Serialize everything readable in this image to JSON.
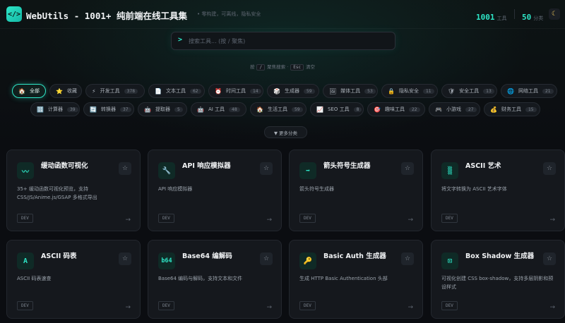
{
  "header": {
    "logo_glyph": "</>",
    "brand_en": "WebUtils - 1001+ ",
    "brand_cn": "纯前端在线工具集",
    "tagline": "• 零构建，可离线，隐私安全",
    "tools_count": "1001",
    "tools_label": "工具",
    "categories_count": "50",
    "categories_label": "分类",
    "theme_icon": "moon-icon"
  },
  "search": {
    "prompt": ">",
    "placeholder": "搜索工具... (按 / 聚焦)"
  },
  "hints": {
    "pre": "按",
    "key1": "/",
    "mid": "聚焦搜索 ·",
    "key2": "Esc",
    "post": "清空"
  },
  "categories": [
    {
      "icon": "🏠",
      "label": "全部",
      "count": "",
      "active": true
    },
    {
      "icon": "⭐",
      "label": "收藏",
      "count": ""
    },
    {
      "icon": "⚡",
      "label": "开发工具",
      "count": "378"
    },
    {
      "icon": "📄",
      "label": "文本工具",
      "count": "62"
    },
    {
      "icon": "⏰",
      "label": "时间工具",
      "count": "14"
    },
    {
      "icon": "🎲",
      "label": "生成器",
      "count": "59"
    },
    {
      "icon": "🖼",
      "label": "媒体工具",
      "count": "53"
    },
    {
      "icon": "🔒",
      "label": "隐私安全",
      "count": "11"
    },
    {
      "icon": "🛡",
      "label": "安全工具",
      "count": "13"
    },
    {
      "icon": "🌐",
      "label": "网络工具",
      "count": "21"
    },
    {
      "icon": "🔢",
      "label": "计算器",
      "count": "39"
    },
    {
      "icon": "🔄",
      "label": "转换器",
      "count": "37"
    },
    {
      "icon": "🤖",
      "label": "提取器",
      "count": "5"
    },
    {
      "icon": "🤖",
      "label": "AI 工具",
      "count": "48"
    },
    {
      "icon": "🏠",
      "label": "生活工具",
      "count": "59"
    },
    {
      "icon": "📈",
      "label": "SEO 工具",
      "count": "8"
    },
    {
      "icon": "🎯",
      "label": "趣味工具",
      "count": "22"
    },
    {
      "icon": "🎮",
      "label": "小游戏",
      "count": "27"
    },
    {
      "icon": "💰",
      "label": "财务工具",
      "count": "15"
    }
  ],
  "more_button": "▼ 更多分类",
  "cards": [
    {
      "icon": "〰",
      "title": "缓动函数可视化",
      "desc": "35+ 缓动函数可视化预览，支持 CSS/JS/Anime.js/GSAP 多格式导出",
      "tag": "DEV"
    },
    {
      "icon": "🔧",
      "title": "API 响应模拟器",
      "desc": "API 响应模拟器",
      "tag": "DEV"
    },
    {
      "icon": "➡",
      "title": "箭头符号生成器",
      "desc": "箭头符号生成器",
      "tag": "DEV"
    },
    {
      "icon": "▒",
      "title": "ASCII 艺术",
      "desc": "将文字转换为 ASCII 艺术字体",
      "tag": "DEV"
    },
    {
      "icon": "A",
      "title": "ASCII 码表",
      "desc": "ASCII 码表速查",
      "tag": "DEV"
    },
    {
      "icon": "b64",
      "title": "Base64 编解码",
      "desc": "Base64 编码与解码，支持文本和文件",
      "tag": "DEV"
    },
    {
      "icon": "🔑",
      "title": "Basic Auth 生成器",
      "desc": "生成 HTTP Basic Authentication 头部",
      "tag": "DEV"
    },
    {
      "icon": "⊡",
      "title": "Box Shadow 生成器",
      "desc": "可视化创建 CSS box-shadow，支持多层阴影和预设样式",
      "tag": "DEV"
    }
  ],
  "colors": {
    "accent": "#2ee6c7",
    "background": "#0b0d11",
    "card": "#15181d"
  },
  "card_arrow": "→",
  "star_glyph": "☆"
}
